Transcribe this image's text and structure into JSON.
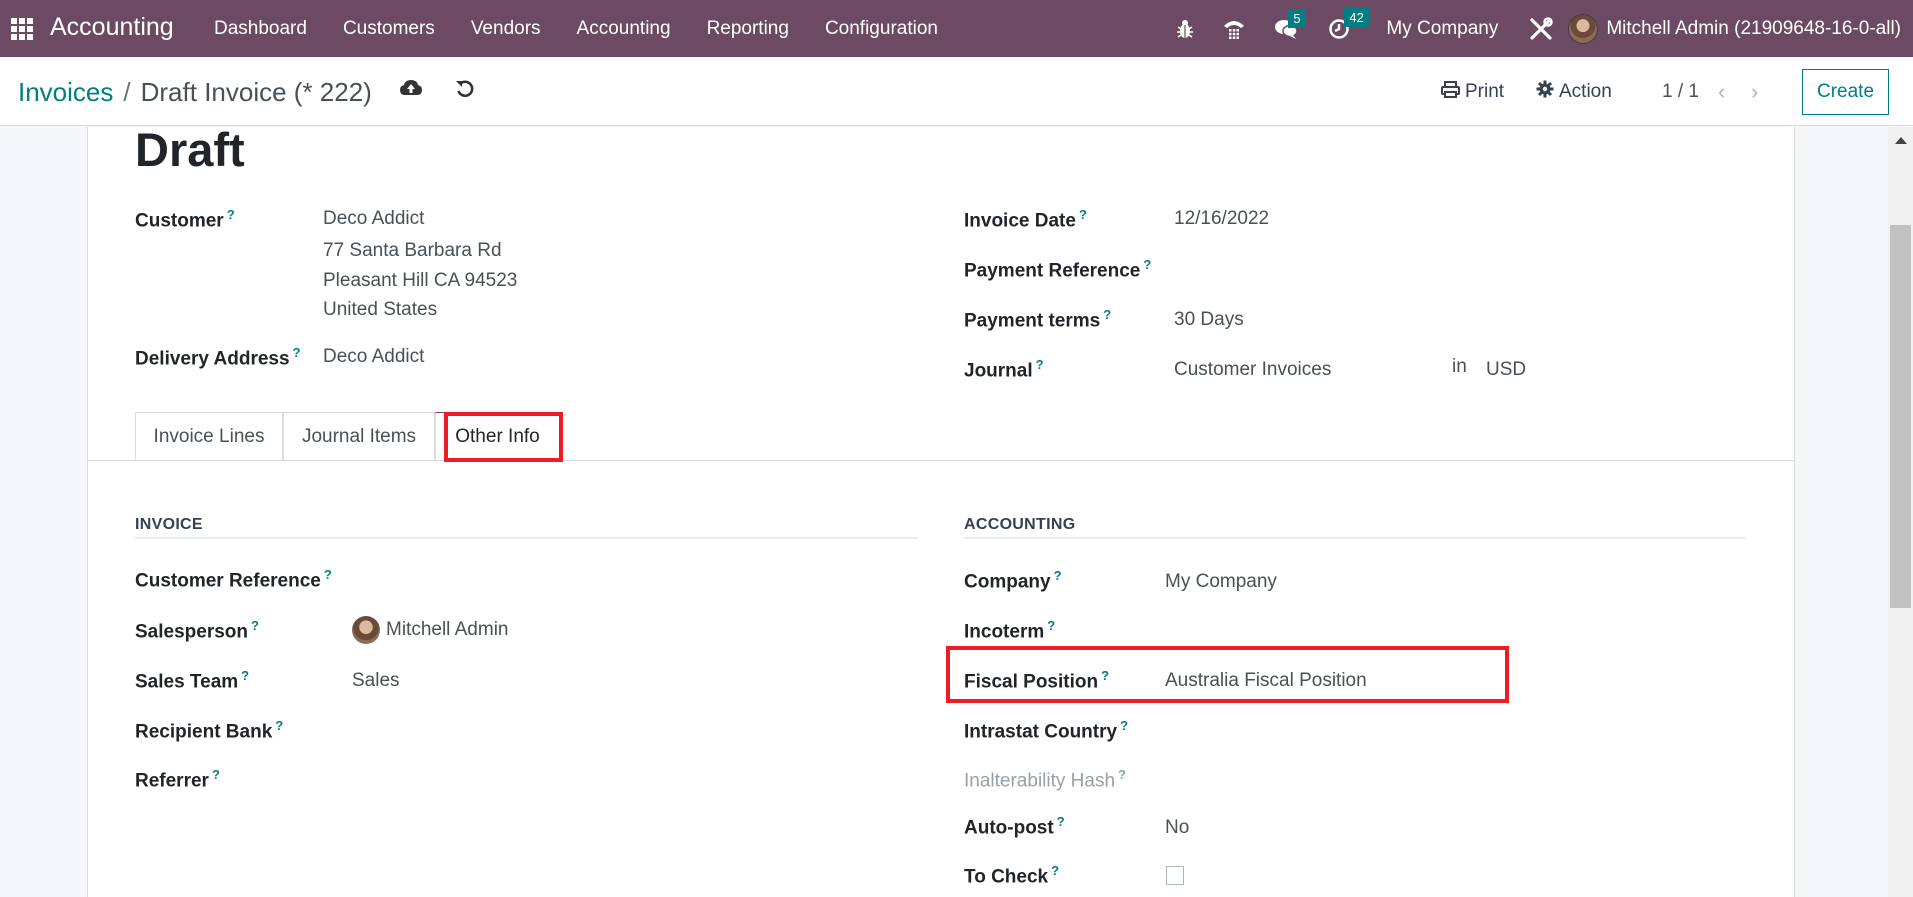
{
  "navbar": {
    "app_name": "Accounting",
    "menu": [
      "Dashboard",
      "Customers",
      "Vendors",
      "Accounting",
      "Reporting",
      "Configuration"
    ],
    "messages_count": "5",
    "activities_count": "42",
    "company": "My Company",
    "user": "Mitchell Admin (21909648-16-0-all)"
  },
  "control_panel": {
    "breadcrumb_parent": "Invoices",
    "breadcrumb_separator": "/",
    "breadcrumb_current": "Draft Invoice (* 222)",
    "print_label": "Print",
    "action_label": "Action",
    "pager": "1 / 1",
    "create_label": "Create"
  },
  "form": {
    "status_title": "Draft",
    "customer_label": "Customer",
    "customer_name": "Deco Addict",
    "customer_address": [
      "77 Santa Barbara Rd",
      "Pleasant Hill CA 94523",
      "United States"
    ],
    "delivery_label": "Delivery Address",
    "delivery_value": "Deco Addict",
    "invoice_date_label": "Invoice Date",
    "invoice_date_value": "12/16/2022",
    "payment_ref_label": "Payment Reference",
    "payment_ref_value": "",
    "payment_terms_label": "Payment terms",
    "payment_terms_value": "30 Days",
    "journal_label": "Journal",
    "journal_value": "Customer Invoices",
    "journal_in": "in",
    "currency": "USD"
  },
  "tabs": [
    {
      "label": "Invoice Lines",
      "active": false
    },
    {
      "label": "Journal Items",
      "active": false
    },
    {
      "label": "Other Info",
      "active": true
    }
  ],
  "other_info": {
    "invoice_section": "INVOICE",
    "accounting_section": "ACCOUNTING",
    "invoice_fields": [
      {
        "label": "Customer Reference",
        "value": ""
      },
      {
        "label": "Salesperson",
        "value": "Mitchell Admin"
      },
      {
        "label": "Sales Team",
        "value": "Sales"
      },
      {
        "label": "Recipient Bank",
        "value": ""
      },
      {
        "label": "Referrer",
        "value": ""
      }
    ],
    "accounting_fields": [
      {
        "label": "Company",
        "value": "My Company"
      },
      {
        "label": "Incoterm",
        "value": ""
      },
      {
        "label": "Fiscal Position",
        "value": "Australia Fiscal Position"
      },
      {
        "label": "Intrastat Country",
        "value": ""
      },
      {
        "label": "Inalterability Hash",
        "value": ""
      },
      {
        "label": "Auto-post",
        "value": "No"
      },
      {
        "label": "To Check",
        "value": false
      }
    ],
    "help_mark": "?"
  },
  "colors": {
    "navbar": "#6c4a64",
    "accent": "#017e84",
    "highlight": "#ee1c25"
  }
}
